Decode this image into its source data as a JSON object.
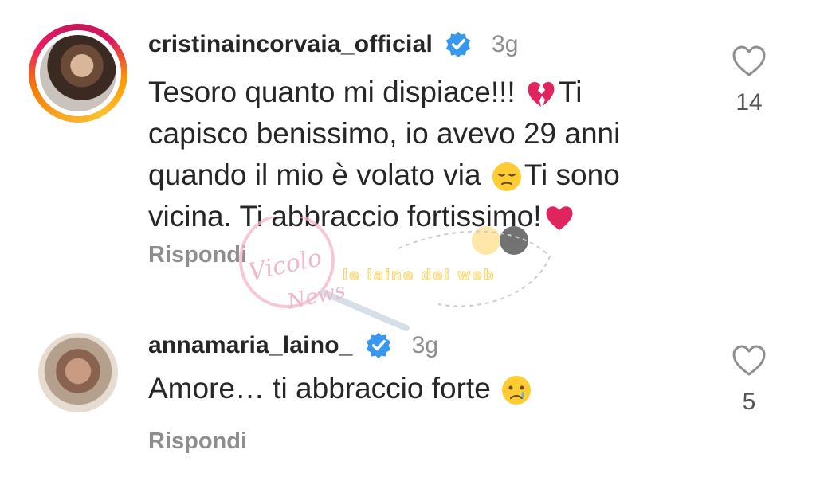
{
  "comments": [
    {
      "username": "cristinaincorvaia_official",
      "time": "3g",
      "text_parts": [
        "Tesoro quanto mi dispiace!!! ",
        "Ti capisco benissimo, io avevo 29 anni quando il mio è volato via ",
        "Ti sono vicina. Ti abbraccio fortissimo!"
      ],
      "emojis": [
        "broken-heart-icon",
        "pensive-face-icon",
        "red-heart-icon"
      ],
      "reply_label": "Rispondi",
      "likes": "14",
      "has_story_ring": true
    },
    {
      "username": "annamaria_laino_",
      "time": "3g",
      "text_parts": [
        "Amore… ti abbraccio forte "
      ],
      "emojis": [
        "crying-face-icon"
      ],
      "reply_label": "Rispondi",
      "likes": "5",
      "has_story_ring": false
    }
  ],
  "watermark": {
    "logo_text": "Vicolo delle News",
    "text": "le laine del web"
  },
  "colors": {
    "text": "#262626",
    "secondary": "#8e8e8e",
    "verified": "#3897f0",
    "heart_red": "#e0245e"
  }
}
